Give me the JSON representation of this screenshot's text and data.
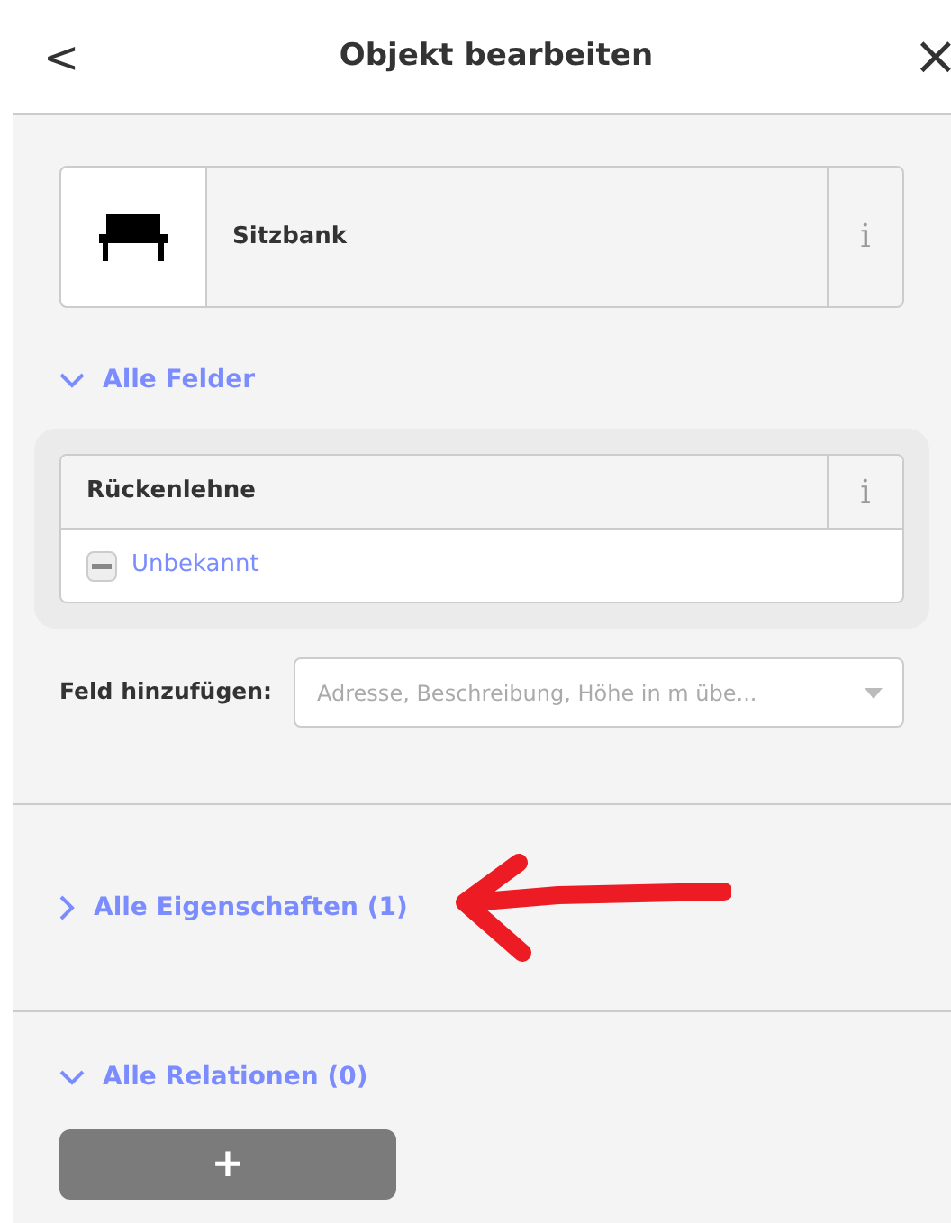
{
  "header": {
    "back": "<",
    "title": "Objekt bearbeiten",
    "close": "×"
  },
  "preset": {
    "name": "Sitzbank",
    "info": "i"
  },
  "sections": [
    {
      "kind": "fields",
      "title": "Alle Felder",
      "expanded": true,
      "fields": [
        {
          "label": "Rückenlehne",
          "info": "i",
          "indeterminate": true,
          "value": "Unbekannt"
        }
      ],
      "add_field": {
        "label": "Feld hinzufügen:",
        "placeholder": "Adresse, Beschreibung, Höhe in m übe..."
      }
    },
    {
      "title": "Alle Eigenschaften (1)",
      "expanded": false,
      "annotated": true
    },
    {
      "kind": "relations",
      "title": "Alle Relationen (0)",
      "expanded": true,
      "add_button": "+"
    }
  ]
}
